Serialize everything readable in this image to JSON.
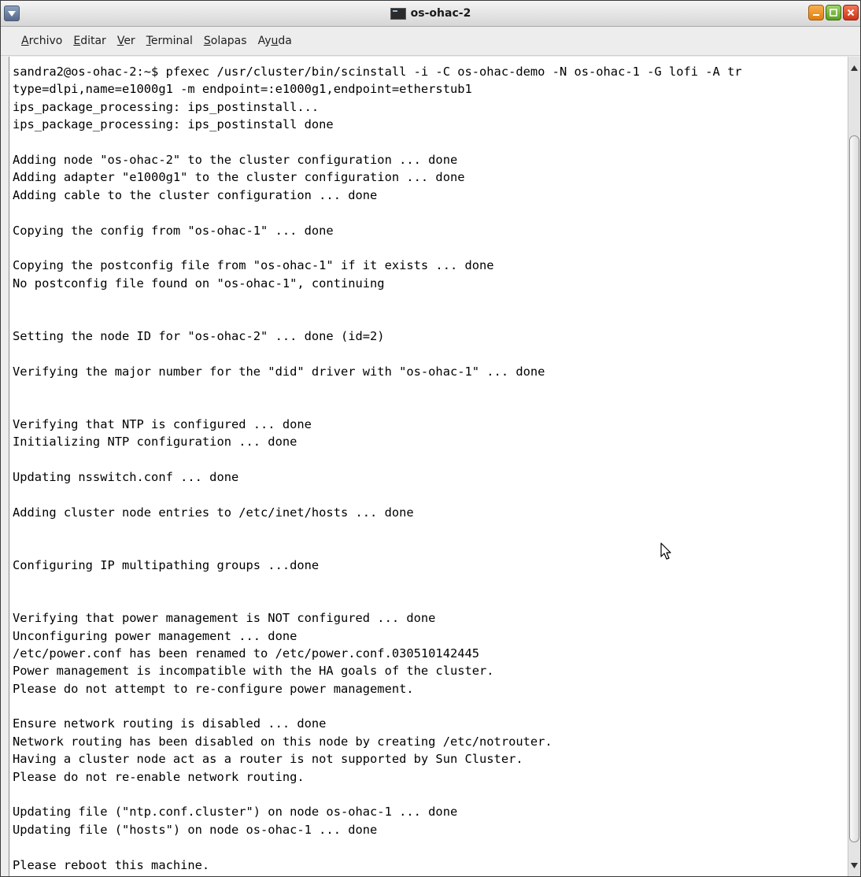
{
  "window": {
    "title": "os-ohac-2"
  },
  "menubar": {
    "items": [
      {
        "label": "Archivo",
        "mnemonic": "A",
        "rest": "rchivo"
      },
      {
        "label": "Editar",
        "mnemonic": "E",
        "rest": "ditar"
      },
      {
        "label": "Ver",
        "mnemonic": "V",
        "rest": "er"
      },
      {
        "label": "Terminal",
        "mnemonic": "T",
        "rest": "erminal"
      },
      {
        "label": "Solapas",
        "mnemonic": "S",
        "rest": "olapas"
      },
      {
        "label": "Ayuda",
        "pre": "Ay",
        "mnemonic": "u",
        "rest": "da"
      }
    ]
  },
  "terminal": {
    "lines": [
      "sandra2@os-ohac-2:~$ pfexec /usr/cluster/bin/scinstall -i -C os-ohac-demo -N os-ohac-1 -G lofi -A tr",
      "type=dlpi,name=e1000g1 -m endpoint=:e1000g1,endpoint=etherstub1",
      "ips_package_processing: ips_postinstall...",
      "ips_package_processing: ips_postinstall done",
      "",
      "Adding node \"os-ohac-2\" to the cluster configuration ... done",
      "Adding adapter \"e1000g1\" to the cluster configuration ... done",
      "Adding cable to the cluster configuration ... done",
      "",
      "Copying the config from \"os-ohac-1\" ... done",
      "",
      "Copying the postconfig file from \"os-ohac-1\" if it exists ... done",
      "No postconfig file found on \"os-ohac-1\", continuing",
      "",
      "",
      "Setting the node ID for \"os-ohac-2\" ... done (id=2)",
      "",
      "Verifying the major number for the \"did\" driver with \"os-ohac-1\" ... done",
      "",
      "",
      "Verifying that NTP is configured ... done",
      "Initializing NTP configuration ... done",
      "",
      "Updating nsswitch.conf ... done",
      "",
      "Adding cluster node entries to /etc/inet/hosts ... done",
      "",
      "",
      "Configuring IP multipathing groups ...done",
      "",
      "",
      "Verifying that power management is NOT configured ... done",
      "Unconfiguring power management ... done",
      "/etc/power.conf has been renamed to /etc/power.conf.030510142445",
      "Power management is incompatible with the HA goals of the cluster.",
      "Please do not attempt to re-configure power management.",
      "",
      "Ensure network routing is disabled ... done",
      "Network routing has been disabled on this node by creating /etc/notrouter.",
      "Having a cluster node act as a router is not supported by Sun Cluster.",
      "Please do not re-enable network routing.",
      "",
      "Updating file (\"ntp.conf.cluster\") on node os-ohac-1 ... done",
      "Updating file (\"hosts\") on node os-ohac-1 ... done",
      "",
      "Please reboot this machine."
    ]
  }
}
